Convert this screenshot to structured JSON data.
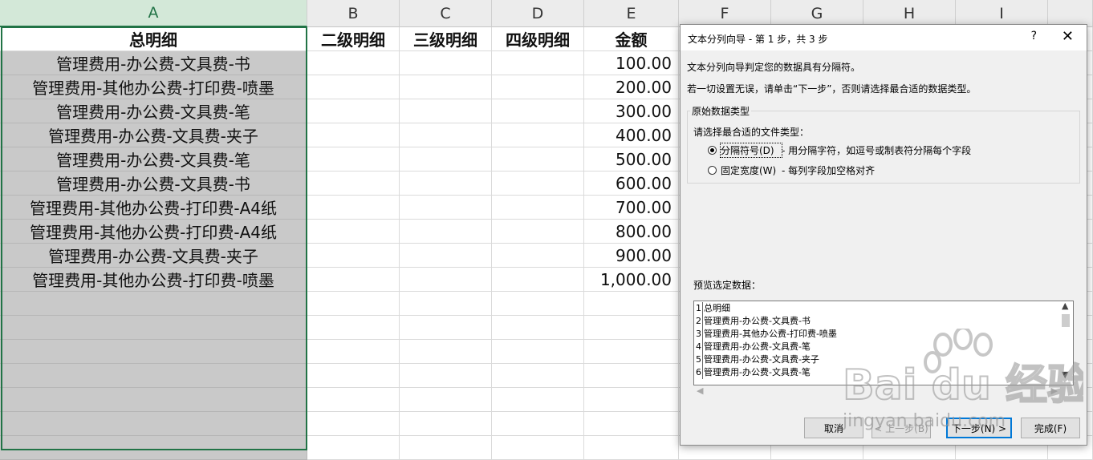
{
  "columns": [
    "A",
    "B",
    "C",
    "D",
    "E",
    "F",
    "G",
    "H",
    "I"
  ],
  "header_row": [
    "总明细",
    "二级明细",
    "三级明细",
    "四级明细",
    "金额"
  ],
  "rows": [
    {
      "a": "管理费用-办公费-文具费-书",
      "e": "100.00"
    },
    {
      "a": "管理费用-其他办公费-打印费-喷墨",
      "e": "200.00"
    },
    {
      "a": "管理费用-办公费-文具费-笔",
      "e": "300.00"
    },
    {
      "a": "管理费用-办公费-文具费-夹子",
      "e": "400.00"
    },
    {
      "a": "管理费用-办公费-文具费-笔",
      "e": "500.00"
    },
    {
      "a": "管理费用-办公费-文具费-书",
      "e": "600.00"
    },
    {
      "a": "管理费用-其他办公费-打印费-A4纸",
      "e": "700.00"
    },
    {
      "a": "管理费用-其他办公费-打印费-A4纸",
      "e": "800.00"
    },
    {
      "a": "管理费用-办公费-文具费-夹子",
      "e": "900.00"
    },
    {
      "a": "管理费用-其他办公费-打印费-喷墨",
      "e": "1,000.00"
    }
  ],
  "dialog": {
    "title": "文本分列向导 - 第 1 步，共 3 步",
    "help": "?",
    "close": "✕",
    "line1": "文本分列向导判定您的数据具有分隔符。",
    "line2": "若一切设置无误，请单击“下一步”，否则请选择最合适的数据类型。",
    "group_label": "原始数据类型",
    "choose_label": "请选择最合适的文件类型：",
    "radio_delimited": "分隔符号(D)",
    "radio_delimited_desc": "- 用分隔字符，如逗号或制表符分隔每个字段",
    "radio_fixed": "固定宽度(W)",
    "radio_fixed_desc": "- 每列字段加空格对齐",
    "preview_label": "预览选定数据：",
    "preview_lines": [
      {
        "n": "1",
        "t": "总明细"
      },
      {
        "n": "2",
        "t": "管理费用-办公费-文具费-书"
      },
      {
        "n": "3",
        "t": "管理费用-其他办公费-打印费-喷墨"
      },
      {
        "n": "4",
        "t": "管理费用-办公费-文具费-笔"
      },
      {
        "n": "5",
        "t": "管理费用-办公费-文具费-夹子"
      },
      {
        "n": "6",
        "t": "管理费用-办公费-文具费-笔"
      }
    ],
    "buttons": {
      "cancel": "取消",
      "back": "< 上一步(B)",
      "next": "下一步(N) >",
      "finish": "完成(F)"
    }
  },
  "watermark": {
    "brand": "Bai du 经验",
    "url": "jingyan.baidu.com"
  }
}
